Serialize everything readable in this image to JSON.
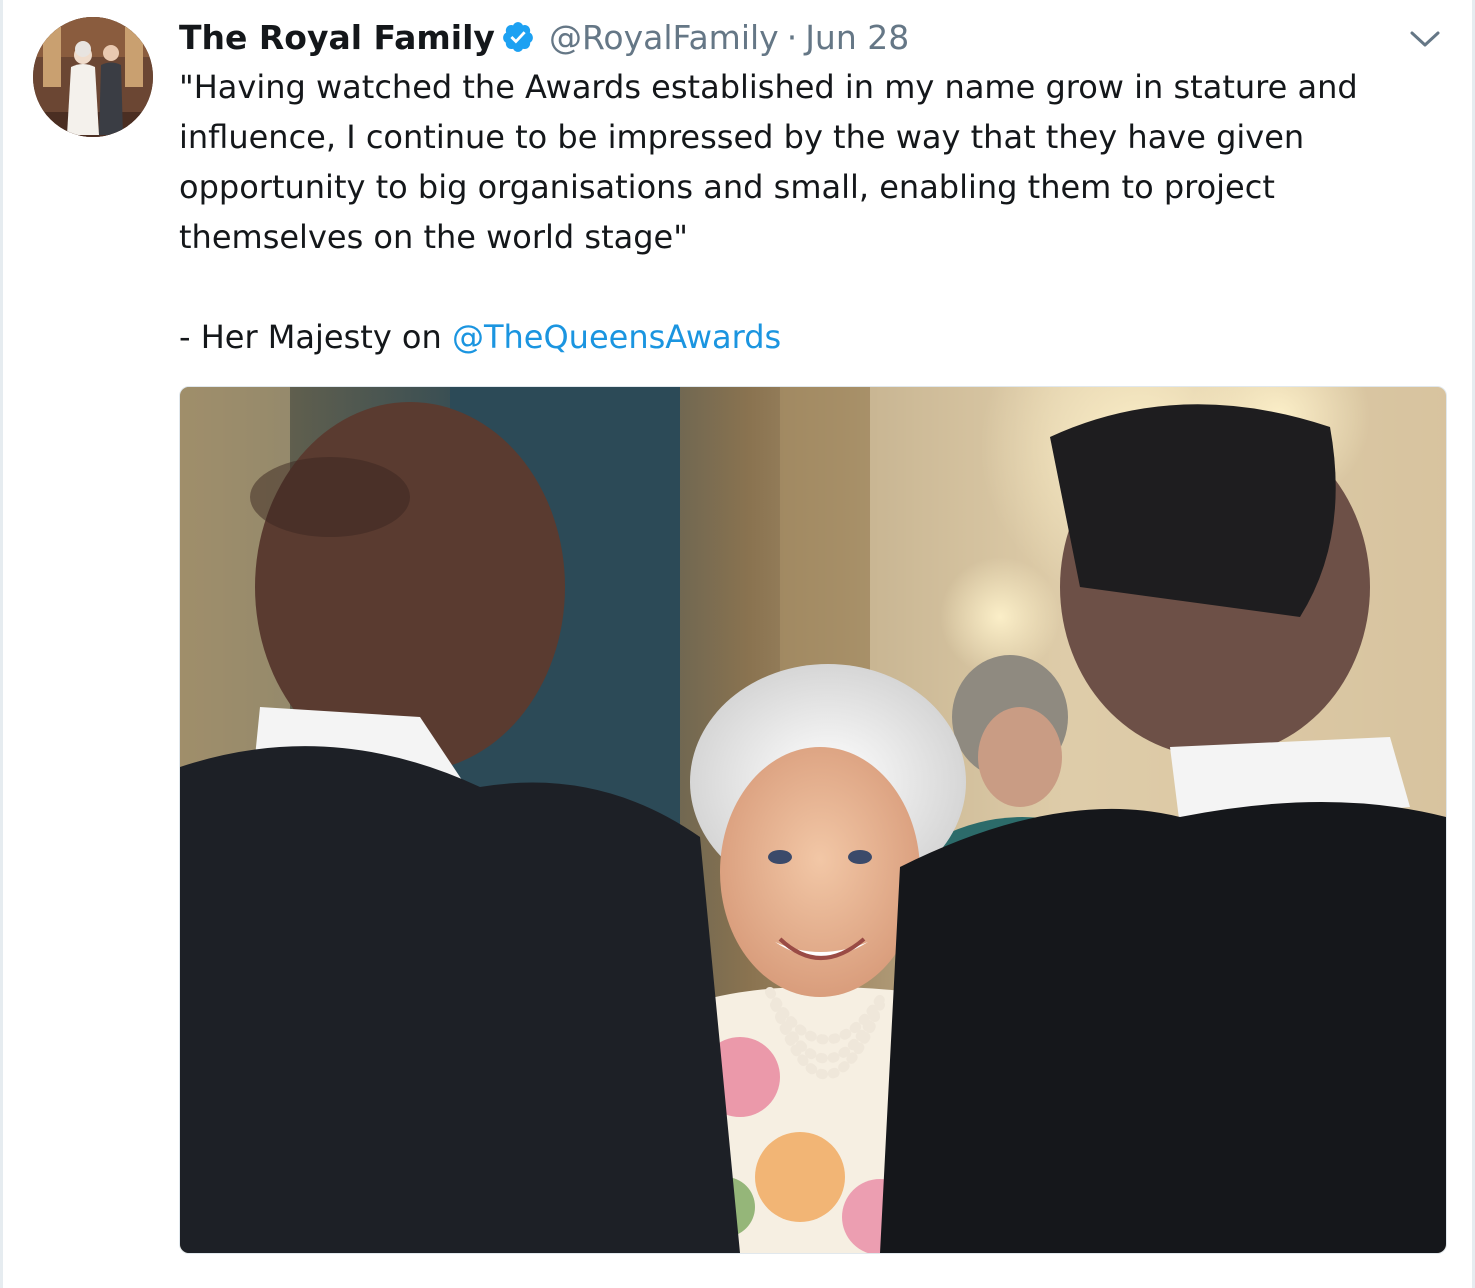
{
  "tweet": {
    "author": {
      "display_name": "The Royal Family",
      "screen_name": "@RoyalFamily",
      "verified": true
    },
    "separator": "·",
    "timestamp": "Jun 28",
    "text_quote": "\"Having watched the Awards established in my name grow in stature and influence, I continue to be impressed by the way that they have given opportunity to big organisations and small, enabling them to project themselves on the world stage\"",
    "attribution_prefix": "- Her Majesty on ",
    "mention": "@TheQueensAwards",
    "icons": {
      "verified": "verified-badge-icon",
      "menu": "chevron-down-icon"
    },
    "colors": {
      "link": "#1b95e0",
      "verified": "#1da1f2",
      "secondary_text": "#657786"
    }
  }
}
